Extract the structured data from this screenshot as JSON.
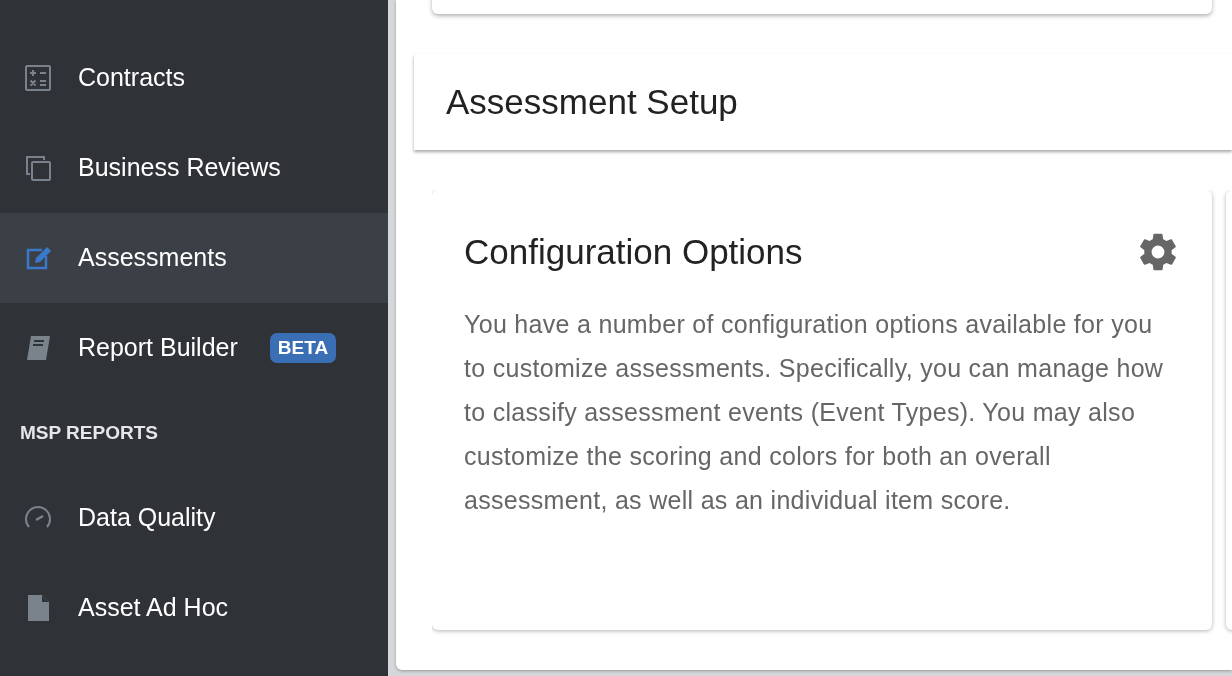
{
  "sidebar": {
    "items": [
      {
        "label": "Contracts",
        "selected": false
      },
      {
        "label": "Business Reviews",
        "selected": false
      },
      {
        "label": "Assessments",
        "selected": true
      },
      {
        "label": "Report Builder",
        "selected": false,
        "badge": "BETA"
      }
    ],
    "section": {
      "title": "MSP REPORTS",
      "items": [
        {
          "label": "Data Quality",
          "selected": false
        },
        {
          "label": "Asset Ad Hoc",
          "selected": false
        }
      ]
    }
  },
  "page": {
    "title": "Assessment Setup"
  },
  "card": {
    "title": "Configuration Options",
    "text": "You have a number of configuration options available for you to customize assessments. Specifically, you can manage how to classify assessment events (Event Types). You may also customize the scoring and colors for both an overall assessment, as well as an individual item score."
  }
}
